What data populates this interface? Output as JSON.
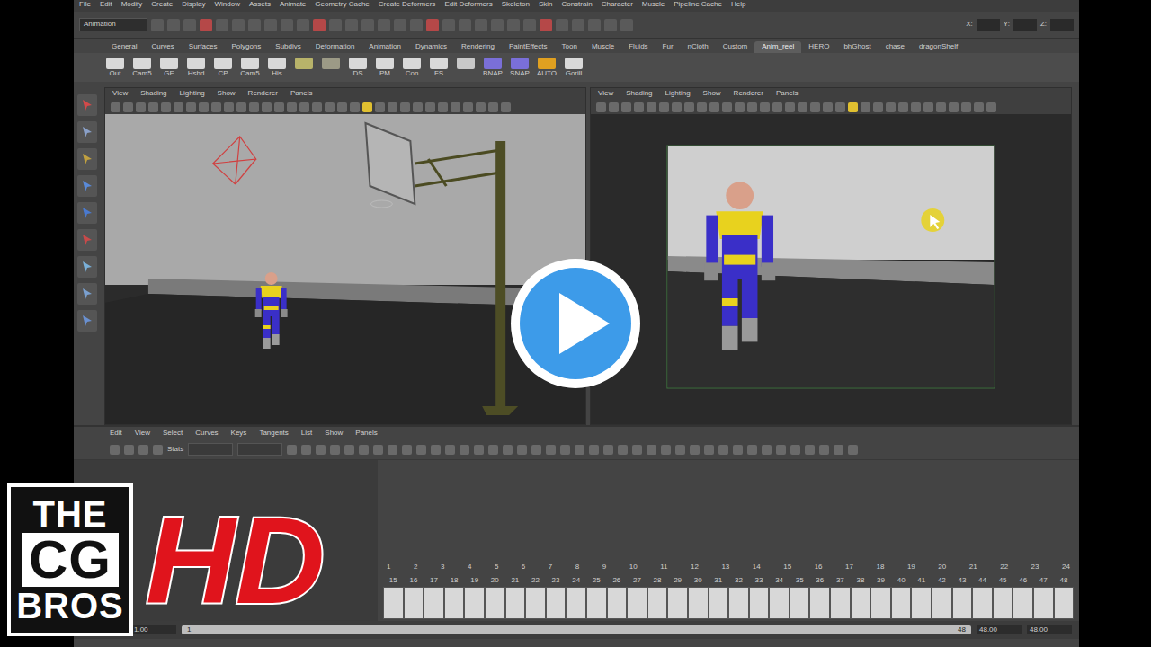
{
  "menu_bar": [
    "File",
    "Edit",
    "Modify",
    "Create",
    "Display",
    "Window",
    "Assets",
    "Animate",
    "Geometry Cache",
    "Create Deformers",
    "Edit Deformers",
    "Skeleton",
    "Skin",
    "Constrain",
    "Character",
    "Muscle",
    "Pipeline Cache",
    "Help"
  ],
  "status_line": {
    "mode": "Animation",
    "coord_labels": [
      "X:",
      "Y:",
      "Z:"
    ]
  },
  "shelf": {
    "tabs": [
      {
        "label": "General",
        "selected": false
      },
      {
        "label": "Curves",
        "selected": false
      },
      {
        "label": "Surfaces",
        "selected": false
      },
      {
        "label": "Polygons",
        "selected": false
      },
      {
        "label": "Subdivs",
        "selected": false
      },
      {
        "label": "Deformation",
        "selected": false
      },
      {
        "label": "Animation",
        "selected": false
      },
      {
        "label": "Dynamics",
        "selected": false
      },
      {
        "label": "Rendering",
        "selected": false
      },
      {
        "label": "PaintEffects",
        "selected": false
      },
      {
        "label": "Toon",
        "selected": false
      },
      {
        "label": "Muscle",
        "selected": false
      },
      {
        "label": "Fluids",
        "selected": false
      },
      {
        "label": "Fur",
        "selected": false
      },
      {
        "label": "nCloth",
        "selected": false
      },
      {
        "label": "Custom",
        "selected": false
      },
      {
        "label": "Anim_reel",
        "selected": true
      },
      {
        "label": "HERO",
        "selected": false
      },
      {
        "label": "bhGhost",
        "selected": false
      },
      {
        "label": "chase",
        "selected": false
      },
      {
        "label": "dragonShelf",
        "selected": false
      }
    ],
    "items": [
      {
        "label": "Out",
        "color": "#d9d9d9"
      },
      {
        "label": "Cam5",
        "color": "#d9d9d9"
      },
      {
        "label": "GE",
        "color": "#d9d9d9"
      },
      {
        "label": "Hshd",
        "color": "#d9d9d9"
      },
      {
        "label": "CP",
        "color": "#d9d9d9"
      },
      {
        "label": "Cam5",
        "color": "#d9d9d9"
      },
      {
        "label": "His",
        "color": "#d9d9d9"
      },
      {
        "label": "",
        "color": "#b8b36a"
      },
      {
        "label": "",
        "color": "#9c9a86"
      },
      {
        "label": "DS",
        "color": "#d9d9d9"
      },
      {
        "label": "PM",
        "color": "#d9d9d9"
      },
      {
        "label": "Con",
        "color": "#d9d9d9"
      },
      {
        "label": "FS",
        "color": "#d9d9d9"
      },
      {
        "label": "",
        "color": "#c9c9c9"
      },
      {
        "label": "BNAP",
        "color": "#7a6fd8"
      },
      {
        "label": "SNAP",
        "color": "#7a6fd8"
      },
      {
        "label": "AUTO",
        "color": "#e0a020"
      },
      {
        "label": "Gorill",
        "color": "#d9d9d9"
      }
    ]
  },
  "viewports": [
    {
      "menu": [
        "View",
        "Shading",
        "Lighting",
        "Show",
        "Renderer",
        "Panels"
      ]
    },
    {
      "menu": [
        "View",
        "Shading",
        "Lighting",
        "Show",
        "Renderer",
        "Panels"
      ]
    }
  ],
  "graph_editor": {
    "menu": [
      "Edit",
      "View",
      "Select",
      "Curves",
      "Keys",
      "Tangents",
      "List",
      "Show",
      "Panels"
    ],
    "stats_label": "Stats"
  },
  "time_slider": {
    "ruler": [
      "1",
      "2",
      "3",
      "4",
      "5",
      "6",
      "7",
      "8",
      "9",
      "10",
      "11",
      "12",
      "13",
      "14",
      "15",
      "16",
      "17",
      "18",
      "19",
      "20",
      "21",
      "22",
      "23",
      "24"
    ],
    "frames": [
      "15",
      "16",
      "17",
      "18",
      "19",
      "20",
      "21",
      "22",
      "23",
      "24",
      "25",
      "26",
      "27",
      "28",
      "29",
      "30",
      "31",
      "32",
      "33",
      "34",
      "35",
      "36",
      "37",
      "38",
      "39",
      "40",
      "41",
      "42",
      "43",
      "44",
      "45",
      "46",
      "47",
      "48"
    ]
  },
  "range_slider": {
    "start": "1.00",
    "inner_start": "1.00",
    "current": "1",
    "end_label": "48",
    "inner_end": "48.00",
    "end": "48.00"
  },
  "logo": {
    "lines": [
      "THE",
      "CG",
      "BROS"
    ],
    "badge": "HD"
  }
}
